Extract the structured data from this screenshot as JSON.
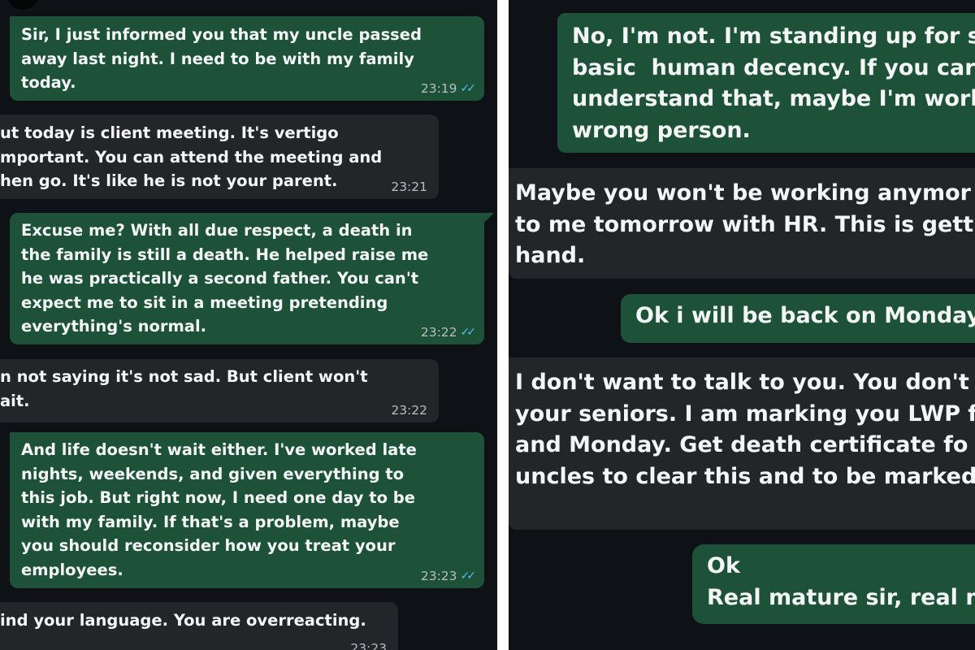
{
  "colors": {
    "background": "#0e1217",
    "outgoing_bubble": "#1d5138",
    "incoming_bubble": "#232528",
    "text": "#f3f5f6",
    "timestamp": "#b6bec4",
    "read_ticks": "#53bdeb"
  },
  "icons": {
    "read_receipt": "double-check-icon"
  },
  "left_panel": {
    "messages": [
      {
        "direction": "outgoing",
        "text": "Sir, I just informed you that my uncle passed\naway last night. I need to be with my family\ntoday.",
        "time": "23:19",
        "read": true
      },
      {
        "direction": "incoming",
        "text": "ut today is client meeting. It's vertigo\nmportant. You can attend the meeting and\nhen go. It's like he is not your parent.",
        "time": "23:21",
        "read": false
      },
      {
        "direction": "outgoing",
        "text": "Excuse me? With all due respect, a death in\nthe family is still a death. He helped raise me\nhe was practically a second father. You can't\nexpect me to sit in a meeting pretending\neverything's normal.",
        "time": "23:22",
        "read": true
      },
      {
        "direction": "incoming",
        "text": "n not saying it's not sad. But client won't\nait.",
        "time": "23:22",
        "read": false
      },
      {
        "direction": "outgoing",
        "text": "And life doesn't wait either. I've worked late\nnights, weekends, and given everything to\nthis job. But right now, I need one day to be\nwith my family. If that's a problem, maybe\nyou should reconsider how you treat your\nemployees.",
        "time": "23:23",
        "read": true
      },
      {
        "direction": "incoming",
        "text": "ind your language. You are overreacting.",
        "time": "23:23",
        "read": false
      }
    ]
  },
  "right_panel": {
    "messages": [
      {
        "direction": "outgoing",
        "text": "No, I'm not. I'm standing up for s\nbasic  human decency. If you car\nunderstand that, maybe I'm work\nwrong person."
      },
      {
        "direction": "incoming",
        "text": "Maybe you won't be working anymor\nto me tomorrow with HR. This is getti\nhand."
      },
      {
        "direction": "outgoing",
        "text": "Ok i will be back on Monday"
      },
      {
        "direction": "incoming",
        "text": "I don't want to talk to you. You don't\nyour seniors. I am marking you LWP f\nand Monday. Get death certificate fo\nuncles to clear this and to be marked"
      },
      {
        "direction": "outgoing",
        "text": "Ok\nReal mature sir, real m"
      }
    ]
  }
}
